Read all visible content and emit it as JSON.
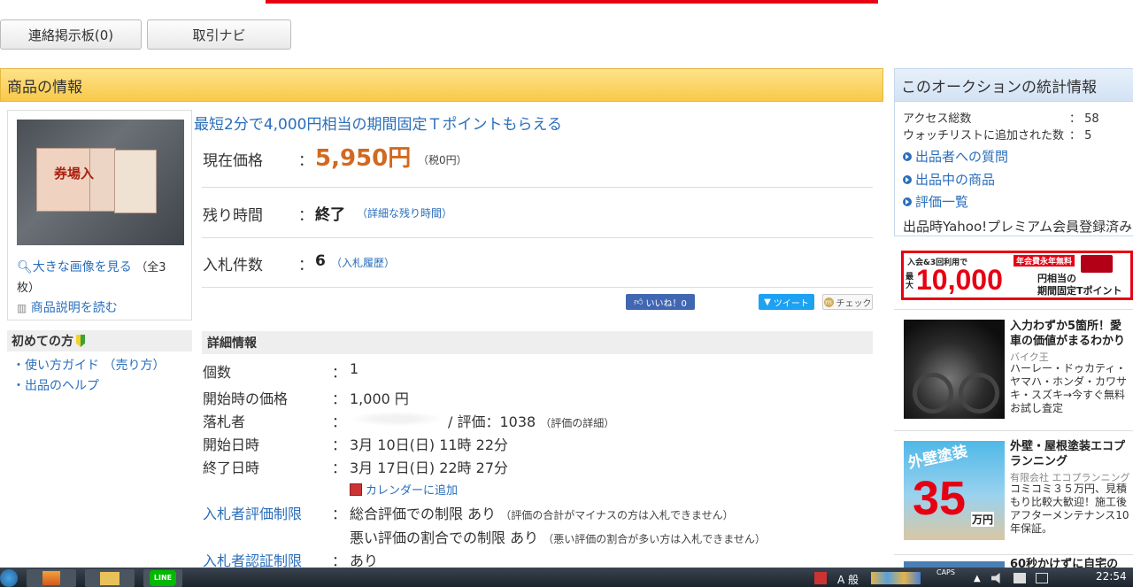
{
  "top_buttons": {
    "board": "連絡掲示板(0)",
    "navi": "取引ナビ"
  },
  "panel": {
    "title": "商品の情報"
  },
  "thumbnail": {
    "ticket_text_1": "券場入",
    "view_large": "大きな画像を見る",
    "count_note_a": "（全3",
    "count_note_b": "枚）",
    "read_desc": "商品説明を読む"
  },
  "beginner": {
    "title": "初めての方",
    "links": [
      "・使い方ガイド （売り方）",
      "・出品のヘルプ"
    ]
  },
  "promo": "最短2分で4,000円相当の期間固定Ｔポイントもらえる",
  "summary": {
    "price_label": "現在価格",
    "price": "5,950円",
    "tax": "（税0円）",
    "time_label": "残り時間",
    "time_value": "終了",
    "time_link": "（詳細な残り時間）",
    "bids_label": "入札件数",
    "bids_value": "6",
    "bids_link": "（入札履歴）",
    "colon": "："
  },
  "social": {
    "like": "いいね！0",
    "tweet": "ツイート",
    "check": "チェック"
  },
  "detail": {
    "head": "詳細情報",
    "colon": "：",
    "qty_label": "個数",
    "qty": "1",
    "start_price_label": "開始時の価格",
    "start_price": "1,000 円",
    "winner_label": "落札者",
    "rating_text": "/ 評価：1038",
    "rating_link": "（評価の詳細）",
    "start_label": "開始日時",
    "start": "3月 10日(日) 11時 22分",
    "end_label": "終了日時",
    "end": "3月 17日(日) 22時 27分",
    "calendar": "カレンダーに追加",
    "restrict_label": "入札者評価制限",
    "restrict_1": "総合評価での制限 あり",
    "restrict_1_note": "（評価の合計がマイナスの方は入札できません）",
    "restrict_2": "悪い評価の割合での制限 あり",
    "restrict_2_note": "（悪い評価の割合が多い方は入札できません）",
    "auth_label": "入札者認証制限",
    "auth": "あり"
  },
  "stats": {
    "title": "このオークションの統計情報",
    "access_label": "アクセス総数",
    "access": "：  58",
    "watch_label": "ウォッチリストに追加された数",
    "watch": "：  5",
    "links": [
      "出品者への質問",
      "出品中の商品",
      "評価一覧"
    ],
    "premium": "出品時Yahoo!プレミアム会員登録済み"
  },
  "banner": {
    "line1": "入会&3回利用で",
    "line1b": "年会費永年無料",
    "prefix": "最大",
    "amount": "10,000",
    "suffix_a": "円相当の",
    "suffix_b": "期間固定Tポイント"
  },
  "ads": [
    {
      "title_a": "入力わずか5箇所！愛",
      "title_b": "車の価値がまるわかり",
      "sponsor": "バイク王",
      "text": [
        "ハーレー・ドゥカティ・",
        "ヤマハ・ホンダ・カワサ",
        "キ・スズキ→今すぐ無料",
        "お試し査定"
      ]
    },
    {
      "title_a": "外壁・屋根塗装エコプ",
      "title_b": "ランニング",
      "sponsor": "有限会社 エコプランニング",
      "image_text": "外壁塗装",
      "image_num": "35",
      "image_unit": "万円",
      "text": [
        "コミコミ３５万円、見積",
        "もり比較大歓迎！施工後",
        "アフターメンテナンス10",
        "年保証。"
      ]
    },
    {
      "title_a": "60秒かけずに自宅の"
    }
  ],
  "taskbar": {
    "caps": "CAPS",
    "time": "22:54",
    "line": "LINE",
    "ime": "A 般"
  },
  "colors": {
    "accent": "#2a6ebb",
    "price": "#d2691e",
    "header": "#f8c94a"
  }
}
